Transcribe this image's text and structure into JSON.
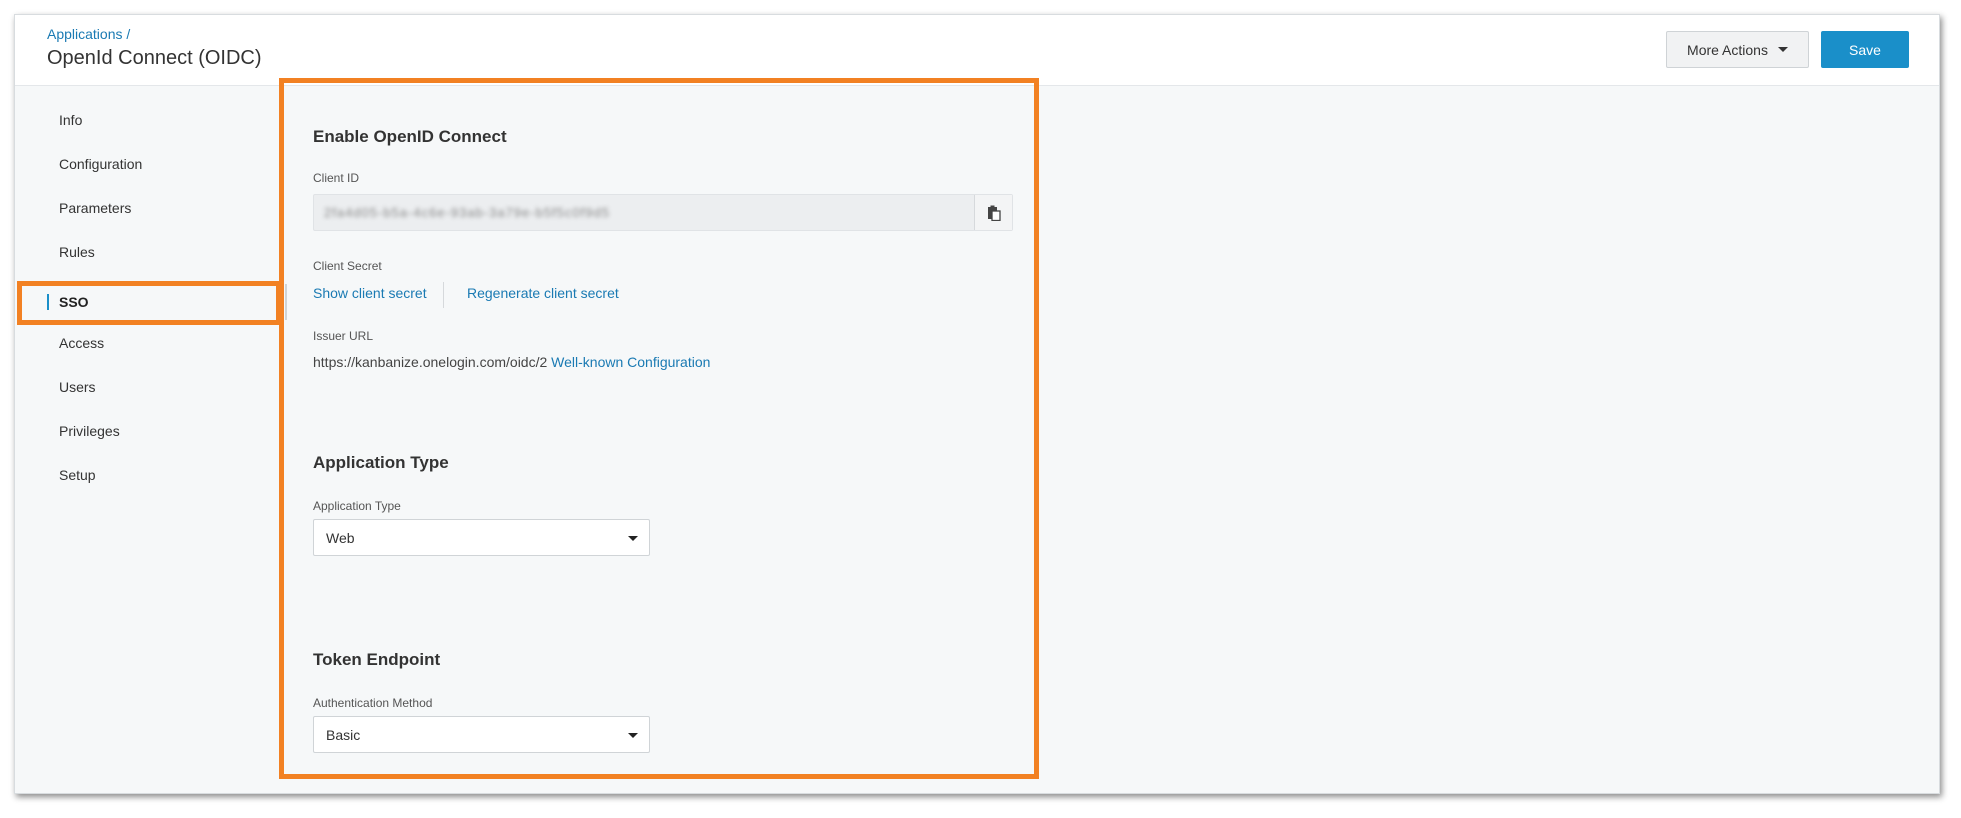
{
  "header": {
    "breadcrumb": "Applications /",
    "title": "OpenId Connect (OIDC)",
    "more_actions_label": "More Actions",
    "save_label": "Save"
  },
  "sidebar": {
    "items": [
      {
        "label": "Info"
      },
      {
        "label": "Configuration"
      },
      {
        "label": "Parameters"
      },
      {
        "label": "Rules"
      },
      {
        "label": "SSO",
        "active": true
      },
      {
        "label": "Access"
      },
      {
        "label": "Users"
      },
      {
        "label": "Privileges"
      },
      {
        "label": "Setup"
      }
    ]
  },
  "sso": {
    "section_title": "Enable OpenID Connect",
    "client_id_label": "Client ID",
    "client_id_value": "2fa4d05-b5a-4c6e-93ab-3a79e-b5f5c0f9d5",
    "client_secret_label": "Client Secret",
    "show_secret_link": "Show client secret",
    "regenerate_secret_link": "Regenerate client secret",
    "issuer_label": "Issuer URL",
    "issuer_url": "https://kanbanize.onelogin.com/oidc/2",
    "well_known_link": "Well-known Configuration"
  },
  "application_type": {
    "section_title": "Application Type",
    "label": "Application Type",
    "selected": "Web"
  },
  "token_endpoint": {
    "section_title": "Token Endpoint",
    "label": "Authentication Method",
    "selected": "Basic"
  },
  "colors": {
    "accent": "#1a8fc9",
    "link": "#1a7ab3",
    "highlight": "#f28123"
  },
  "icons": {
    "copy": "clipboard-copy-icon",
    "dropdown": "caret-down-icon"
  }
}
